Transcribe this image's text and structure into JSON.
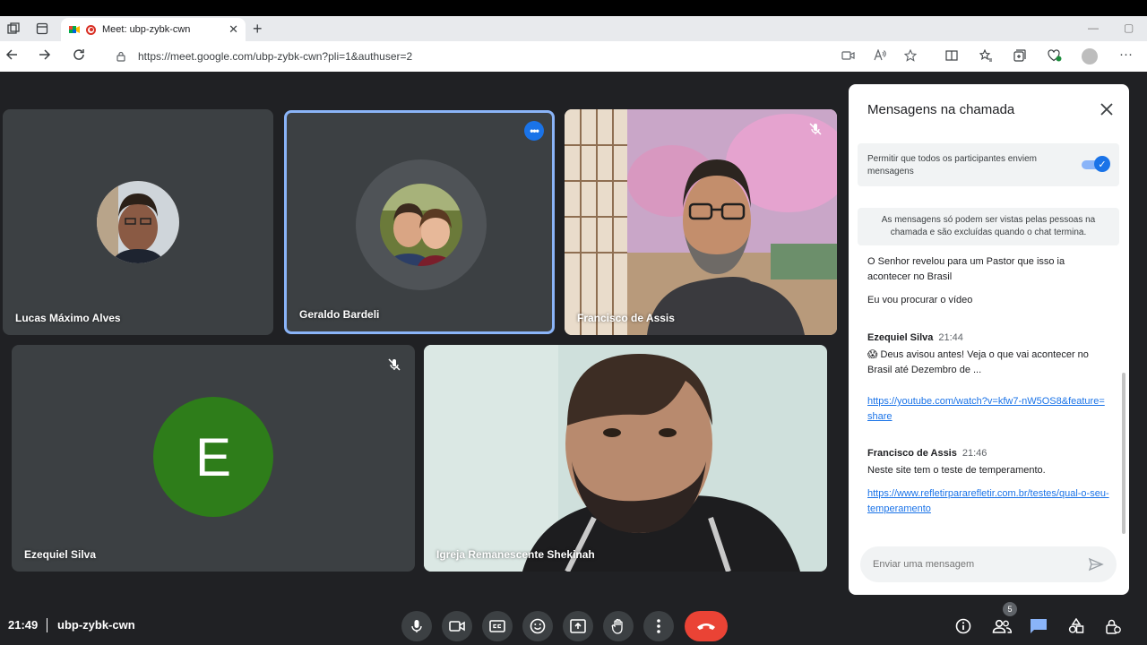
{
  "browser": {
    "tab_title": "Meet: ubp-zybk-cwn",
    "tab_close": "✕",
    "new_tab": "+",
    "url": "https://meet.google.com/ubp-zybk-cwn?pli=1&authuser=2"
  },
  "participants": [
    {
      "name": "Lucas Máximo Alves"
    },
    {
      "name": "Geraldo Bardeli"
    },
    {
      "name": "Francisco de Assis"
    },
    {
      "name": "Ezequiel Silva",
      "initial": "E"
    },
    {
      "name": "Igreja Remanescente Shekinah"
    }
  ],
  "chat": {
    "title": "Mensagens na chamada",
    "permission_text": "Permitir que todos os participantes enviem mensagens",
    "info_text": "As mensagens só podem ser vistas pelas pessoas na chamada e são excluídas quando o chat termina.",
    "messages": [
      {
        "text": "O Senhor revelou para um Pastor que isso ia acontecer no Brasil"
      },
      {
        "text": "Eu vou procurar o vídeo"
      },
      {
        "sender": "Ezequiel Silva",
        "time": "21:44",
        "text": "😱 Deus avisou antes! Veja o que vai acontecer no Brasil até Dezembro de ...",
        "link": "https://youtube.com/watch?v=kfw7-nW5OS8&feature=share"
      },
      {
        "sender": "Francisco de Assis",
        "time": "21:46",
        "text": "Neste site tem o teste de temperamento.",
        "link": "https://www.refletirpararefletir.com.br/testes/qual-o-seu-temperamento"
      }
    ],
    "input_placeholder": "Enviar uma mensagem"
  },
  "footer": {
    "time": "21:49",
    "meeting_code": "ubp-zybk-cwn",
    "participant_count": "5"
  },
  "colors": {
    "background": "#202124",
    "tile": "#3c4043",
    "accent": "#1a73e8",
    "end_call": "#ea4335",
    "avatar_green": "#2e7d1a"
  }
}
